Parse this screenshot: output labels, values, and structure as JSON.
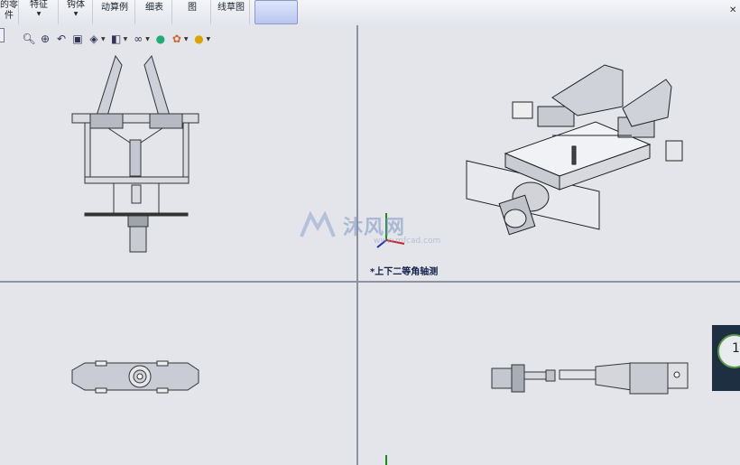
{
  "ribbon": {
    "items": [
      {
        "label": "的零\n件",
        "dropdown": false
      },
      {
        "label": "特征",
        "dropdown": true
      },
      {
        "label": "钩体",
        "dropdown": true
      },
      {
        "label": "动算例",
        "dropdown": false
      },
      {
        "label": "细表",
        "dropdown": false
      },
      {
        "label": "图",
        "dropdown": false
      },
      {
        "label": "线草图",
        "dropdown": false
      },
      {
        "label": "",
        "dropdown": false
      }
    ]
  },
  "heads_up_toolbar": {
    "icons": [
      "zoom-to-fit-icon",
      "zoom-to-area-icon",
      "previous-view-icon",
      "section-view-icon",
      "view-orientation-icon",
      "display-style-icon",
      "hide-show-items-icon",
      "edit-appearance-icon",
      "apply-scene-icon",
      "view-settings-icon"
    ]
  },
  "viewports": {
    "isometric_label": "*上下二等角轴测"
  },
  "watermark": {
    "text": "沐风网",
    "url": "www.mfcad.com"
  },
  "side_widget": {
    "visible_text": "1"
  },
  "colors": {
    "background": "#e3e5ea",
    "divider": "#8d939e",
    "ribbon": "#eceef2"
  }
}
